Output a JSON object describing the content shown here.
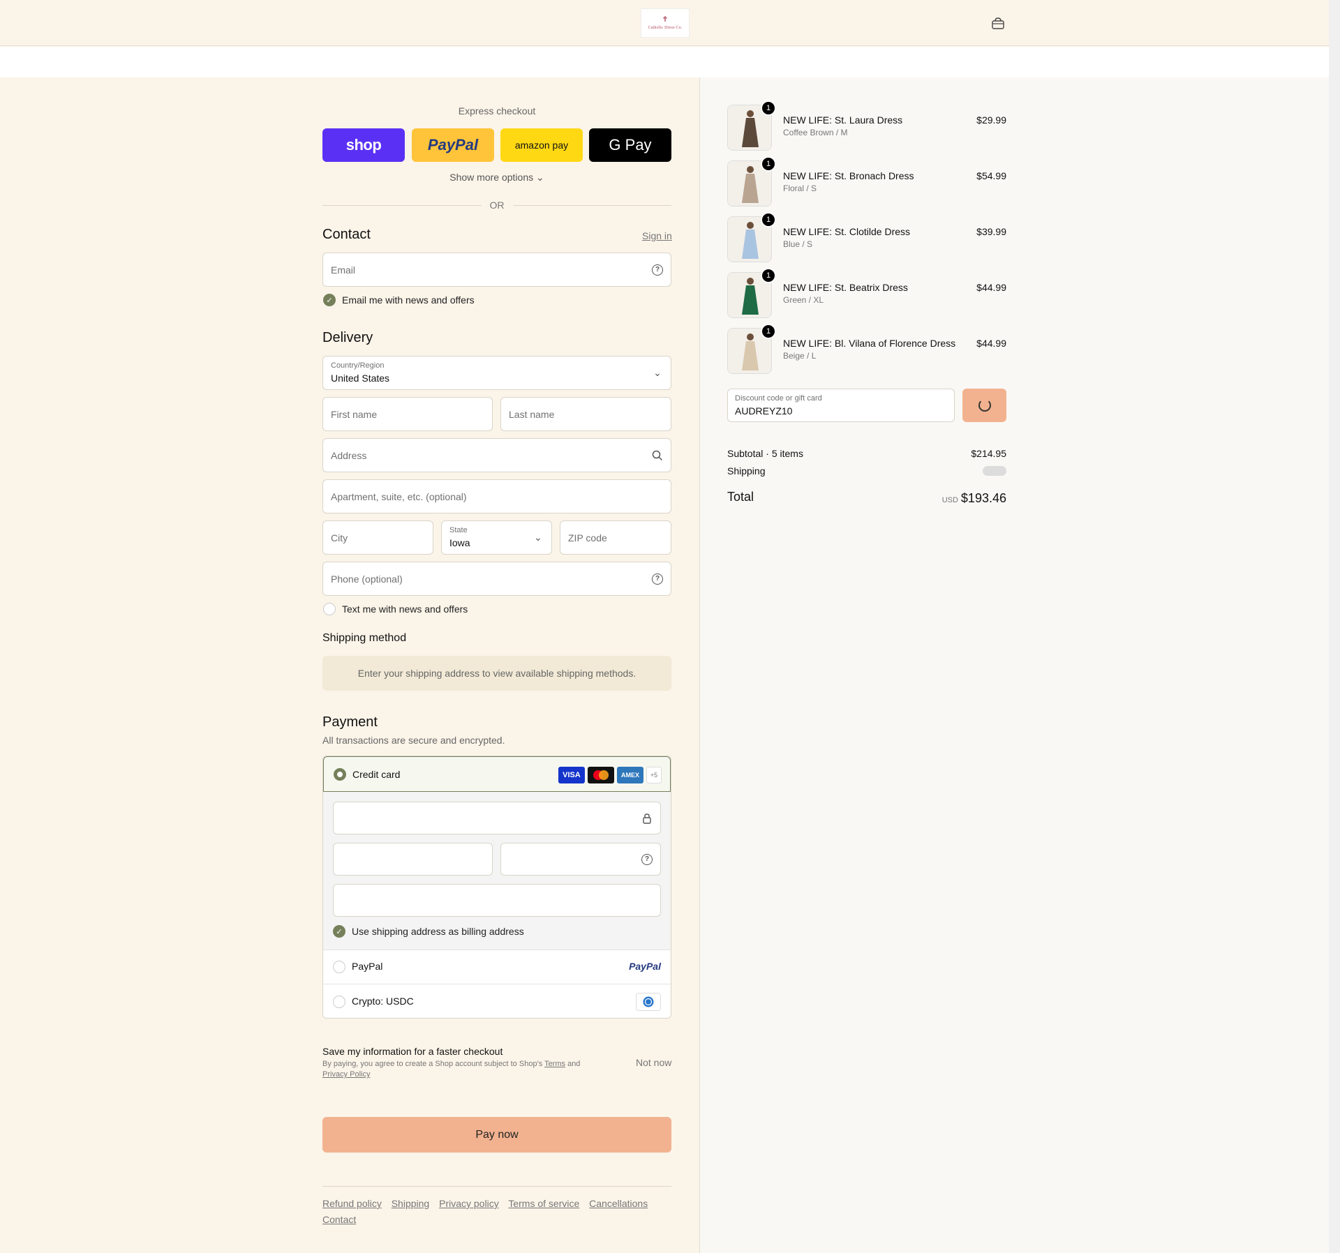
{
  "header": {
    "logo_mark": "✝",
    "logo_text": "Catholic Dress Co.",
    "cart_icon": "bag-icon"
  },
  "express": {
    "title": "Express checkout",
    "shop_label": "shop",
    "paypal_label": "PayPal",
    "amazon_label": "amazon pay",
    "gpay_label": "G Pay",
    "more_options": "Show more options ⌄",
    "or": "OR"
  },
  "contact": {
    "heading": "Contact",
    "sign_in": "Sign in",
    "email_placeholder": "Email",
    "email_news_label": "Email me with news and offers"
  },
  "delivery": {
    "heading": "Delivery",
    "country_label": "Country/Region",
    "country_value": "United States",
    "first_name_placeholder": "First name",
    "last_name_placeholder": "Last name",
    "address_placeholder": "Address",
    "apartment_placeholder": "Apartment, suite, etc. (optional)",
    "city_placeholder": "City",
    "state_label": "State",
    "state_value": "Iowa",
    "zip_placeholder": "ZIP code",
    "phone_placeholder": "Phone (optional)",
    "text_news_label": "Text me with news and offers"
  },
  "shipping": {
    "heading": "Shipping method",
    "info": "Enter your shipping address to view available shipping methods."
  },
  "payment": {
    "heading": "Payment",
    "subtitle": "All transactions are secure and encrypted.",
    "credit_card_label": "Credit card",
    "card_logos": [
      "VISA",
      "",
      "AMEX",
      "+5"
    ],
    "billing_same_label": "Use shipping address as billing address",
    "paypal_label": "PayPal",
    "paypal_logo": "PayPal",
    "crypto_label": "Crypto: USDC"
  },
  "save_info": {
    "title": "Save my information for a faster checkout",
    "desc_prefix": "By paying, you agree to create a Shop account subject to Shop's ",
    "terms": "Terms",
    "and": " and",
    "privacy": "Privacy Policy",
    "not_now": "Not now"
  },
  "pay_now_label": "Pay now",
  "footer_links": [
    "Refund policy",
    "Shipping",
    "Privacy policy",
    "Terms of service",
    "Cancellations",
    "Contact"
  ],
  "cart": {
    "items": [
      {
        "name": "NEW LIFE: St. Laura Dress",
        "variant": "Coffee Brown / M",
        "price": "$29.99",
        "qty": "1",
        "color": "#5b4a3a"
      },
      {
        "name": "NEW LIFE: St. Bronach Dress",
        "variant": "Floral / S",
        "price": "$54.99",
        "qty": "1",
        "color": "#b9a491"
      },
      {
        "name": "NEW LIFE: St. Clotilde Dress",
        "variant": "Blue / S",
        "price": "$39.99",
        "qty": "1",
        "color": "#a9c4e0"
      },
      {
        "name": "NEW LIFE: St. Beatrix Dress",
        "variant": "Green / XL",
        "price": "$44.99",
        "qty": "1",
        "color": "#1f6b46"
      },
      {
        "name": "NEW LIFE: Bl. Vilana of Florence Dress",
        "variant": "Beige / L",
        "price": "$44.99",
        "qty": "1",
        "color": "#d9c8ae"
      }
    ],
    "discount_label": "Discount code or gift card",
    "discount_value": "AUDREYZ10",
    "subtotal_label": "Subtotal · 5 items",
    "subtotal_value": "$214.95",
    "shipping_label": "Shipping",
    "total_label": "Total",
    "currency": "USD",
    "total_value": "$193.46"
  }
}
